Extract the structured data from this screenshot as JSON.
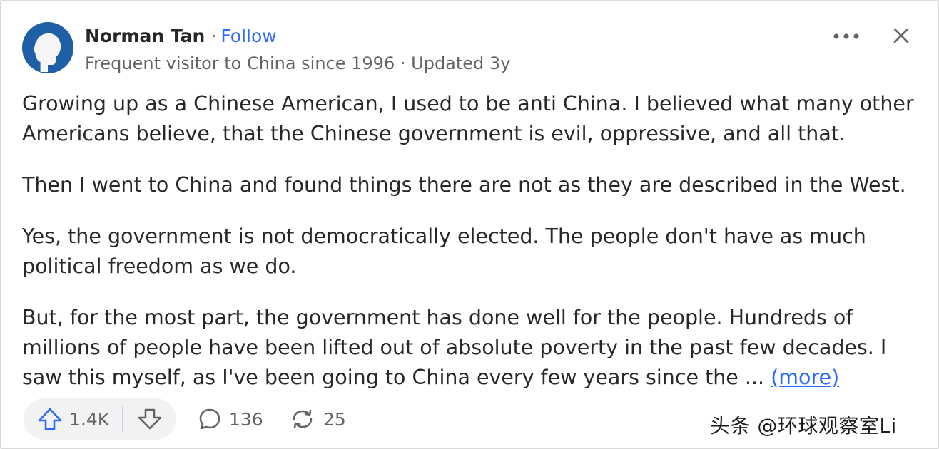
{
  "author": {
    "name": "Norman Tan",
    "separator": "·",
    "follow_label": "Follow",
    "credential": "Frequent visitor to China since 1996",
    "byline_separator": "·",
    "updated": "Updated 3y"
  },
  "content": {
    "paragraphs": [
      "Growing up as a Chinese American, I used to be anti China. I believed what many other Americans believe, that the Chinese government is evil, oppressive, and all that.",
      "Then I went to China and found things there are not as they are described in the West.",
      "Yes, the government is not democratically elected. The people don't have as much political freedom as we do.",
      "But, for the most part, the government has done well for the people. Hundreds of millions of people have been lifted out of absolute poverty in the past few decades. I saw this myself, as I've been going to China every few years since the ..."
    ],
    "more_label": "(more)"
  },
  "actions": {
    "upvotes": "1.4K",
    "comments": "136",
    "shares": "25"
  },
  "watermark": "头条 @环球观察室Li",
  "colors": {
    "link": "#2e69ff",
    "text": "#282829",
    "muted": "#636466",
    "avatar_bg": "#1f5fa8",
    "pill_bg": "#f1f2f4"
  },
  "icons": {
    "avatar": "default-profile-silhouette",
    "more": "more-horizontal-icon",
    "close": "close-icon",
    "upvote": "upvote-arrow-icon",
    "downvote": "downvote-arrow-icon",
    "comment": "comment-bubble-icon",
    "share": "share-cycle-icon"
  }
}
